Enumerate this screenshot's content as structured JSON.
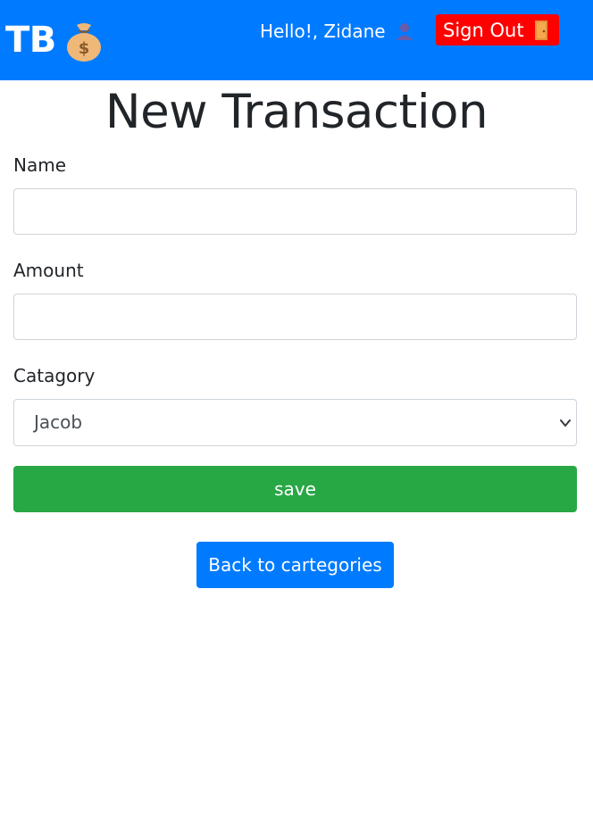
{
  "navbar": {
    "brand": "TB",
    "brand_icon": "moneybag-icon",
    "greeting": "Hello!, Zidane",
    "greeting_icon": "user-icon",
    "signout_label": "Sign Out",
    "signout_icon": "door-icon",
    "color": "#007bff",
    "signout_color": "#ff0000"
  },
  "page": {
    "title": "New Transaction"
  },
  "form": {
    "name_label": "Name",
    "name_value": "",
    "amount_label": "Amount",
    "amount_value": "",
    "category_label": "Catagory",
    "category_selected": "Jacob",
    "save_label": "save",
    "save_color": "#28a745"
  },
  "back_button": {
    "label": "Back to cartegories",
    "color": "#007bff"
  }
}
